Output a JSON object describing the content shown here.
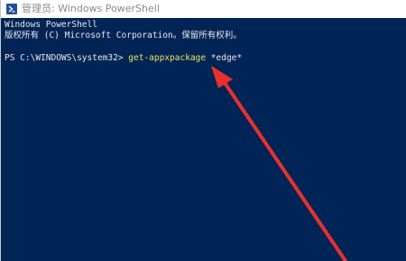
{
  "window": {
    "title": "管理员: Windows PowerShell",
    "icon": "powershell-icon"
  },
  "console": {
    "banner_line1": "Windows PowerShell",
    "banner_line2": "版权所有 (C) Microsoft Corporation。保留所有权利。",
    "prompt": "PS C:\\WINDOWS\\system32> ",
    "command": "get-appxpackage",
    "argument": " *edge*"
  },
  "colors": {
    "console_background": "#012456",
    "console_text": "#e8e8e8",
    "command_highlight": "#f2e35c",
    "annotation_arrow": "#e8312b"
  },
  "annotation": {
    "type": "arrow",
    "color_name": "red"
  }
}
